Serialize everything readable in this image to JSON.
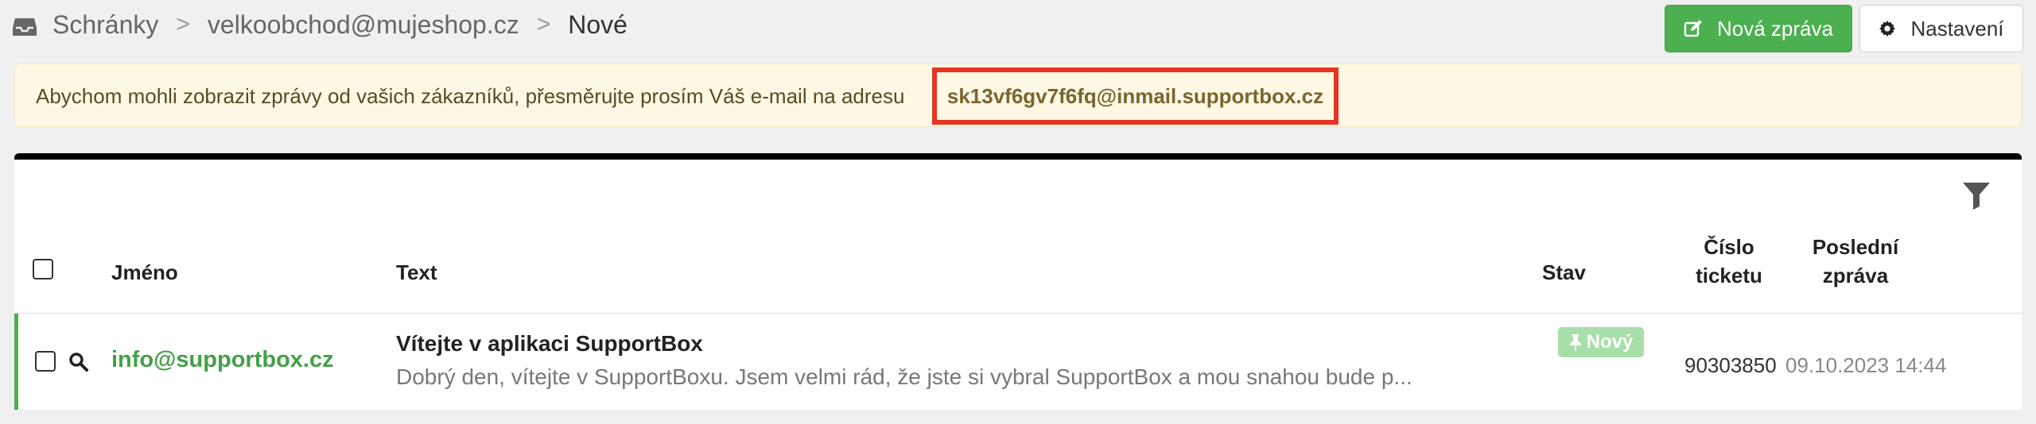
{
  "breadcrumb": {
    "items": [
      "Schránky",
      "velkoobchod@mujeshop.cz",
      "Nové"
    ],
    "separator": ">"
  },
  "toolbar": {
    "new_message_label": "Nová zpráva",
    "settings_label": "Nastavení"
  },
  "alert": {
    "text": "Abychom mohli zobrazit zprávy od vašich zákazníků, přesměrujte prosím Váš e-mail na adresu",
    "email": "sk13vf6gv7f6fq@inmail.supportbox.cz"
  },
  "table": {
    "columns": {
      "name": "Jméno",
      "text": "Text",
      "status": "Stav",
      "ticket_line1": "Číslo",
      "ticket_line2": "ticketu",
      "last_line1": "Poslední",
      "last_line2": "zpráva"
    },
    "rows": [
      {
        "name": "info@supportbox.cz",
        "subject": "Vítejte v aplikaci SupportBox",
        "preview": "Dobrý den, vítejte v SupportBoxu. Jsem velmi rád, že jste si vybral SupportBox a mou snahou bude p...",
        "status": "Nový",
        "ticket": "90303850",
        "last_message": "09.10.2023 14:44"
      }
    ]
  },
  "colors": {
    "accent_green": "#4caf50",
    "alert_bg": "#fcf8e3",
    "highlight_red": "#e63323",
    "badge_green": "#a8dfa8"
  },
  "icons": [
    "inbox-icon",
    "edit-icon",
    "gear-icon",
    "filter-icon",
    "search-icon",
    "pin-icon"
  ]
}
